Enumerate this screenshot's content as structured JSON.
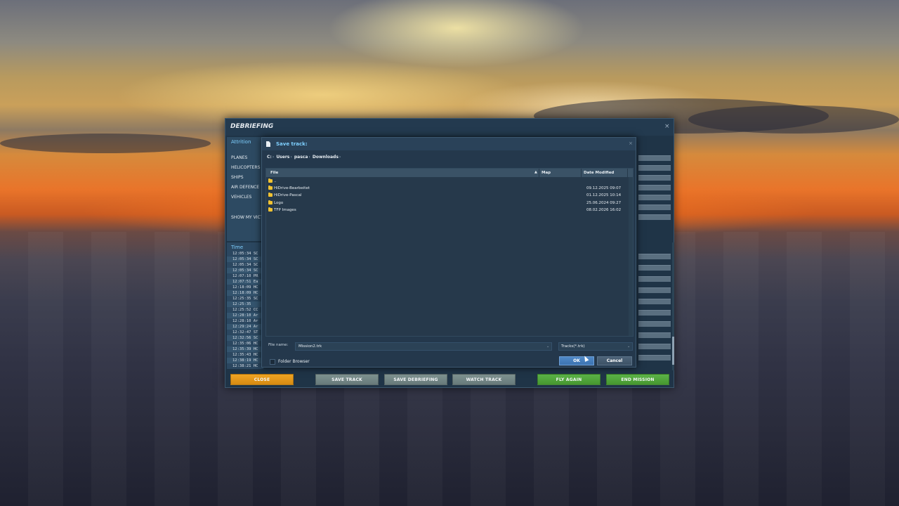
{
  "window": {
    "title": "DEBRIEFING",
    "close_glyph": "×"
  },
  "attrition": {
    "header": "Attrition",
    "items": [
      "PLANES",
      "HELICOPTERS",
      "SHIPS",
      "AIR DEFENCE",
      "VEHICLES"
    ],
    "show_my": "SHOW MY VICT"
  },
  "timeline": {
    "header": "Time",
    "rows": [
      {
        "time": "12:05:34",
        "ev": "SC"
      },
      {
        "time": "12:05:34",
        "ev": "SC"
      },
      {
        "time": "12:05:34",
        "ev": "SC"
      },
      {
        "time": "12:05:34",
        "ev": "SC"
      },
      {
        "time": "12:07:10",
        "ev": "PR"
      },
      {
        "time": "12:07:51",
        "ev": "Ea"
      },
      {
        "time": "12:18:09",
        "ev": "HC"
      },
      {
        "time": "12:18:09",
        "ev": "HC"
      },
      {
        "time": "12:25:35",
        "ev": "SC"
      },
      {
        "time": "12:25:35",
        "ev": ""
      },
      {
        "time": "12:25:52",
        "ev": "CC"
      },
      {
        "time": "12:28:10",
        "ev": "Ar"
      },
      {
        "time": "12:28:10",
        "ev": "Ar"
      },
      {
        "time": "12:29:24",
        "ev": "Ar"
      },
      {
        "time": "12:32:47",
        "ev": "ST"
      },
      {
        "time": "12:32:56",
        "ev": "SC"
      },
      {
        "time": "12:35:06",
        "ev": "HC"
      },
      {
        "time": "12:35:39",
        "ev": "HC"
      },
      {
        "time": "12:35:43",
        "ev": "HC"
      },
      {
        "time": "12:38:19",
        "ev": "HC"
      },
      {
        "time": "12:38:21",
        "ev": "HC"
      }
    ]
  },
  "footer_buttons": {
    "close": "CLOSE",
    "save_track": "SAVE TRACK",
    "save_debriefing": "SAVE DEBRIEFING",
    "watch_track": "WATCH TRACK",
    "fly_again": "FLY AGAIN",
    "end_mission": "END MISSION"
  },
  "dialog": {
    "title": "Save track:",
    "close_glyph": "×",
    "breadcrumb": [
      "C:",
      "Users",
      "pasca",
      "Downloads"
    ],
    "columns": {
      "file": "File",
      "map": "Map",
      "date": "Date Modified",
      "sort_glyph": "▲"
    },
    "files": [
      {
        "name": "..",
        "date": ""
      },
      {
        "name": "HiDrive-Bearbeitet",
        "date": "09.12.2025 09:07"
      },
      {
        "name": "HiDrive-Pascal",
        "date": "01.12.2025 10:14"
      },
      {
        "name": "Logo",
        "date": "25.06.2024 09:27"
      },
      {
        "name": "TFP Images",
        "date": "08.02.2026 16:02"
      }
    ],
    "filename_label": "File name:",
    "filename_value": "Mission2.trk",
    "filter_value": "Tracks(*.trk)",
    "folder_browser_label": "Folder Browser",
    "ok_label": "OK",
    "cancel_label": "Cancel",
    "chevron_glyph": "⌄"
  },
  "colors": {
    "accent_blue": "#7fd0ff",
    "close_orange": "#f0a523",
    "neutral_grey": "#7f9391",
    "action_green": "#5cb348",
    "ok_blue": "#4f88c6"
  }
}
